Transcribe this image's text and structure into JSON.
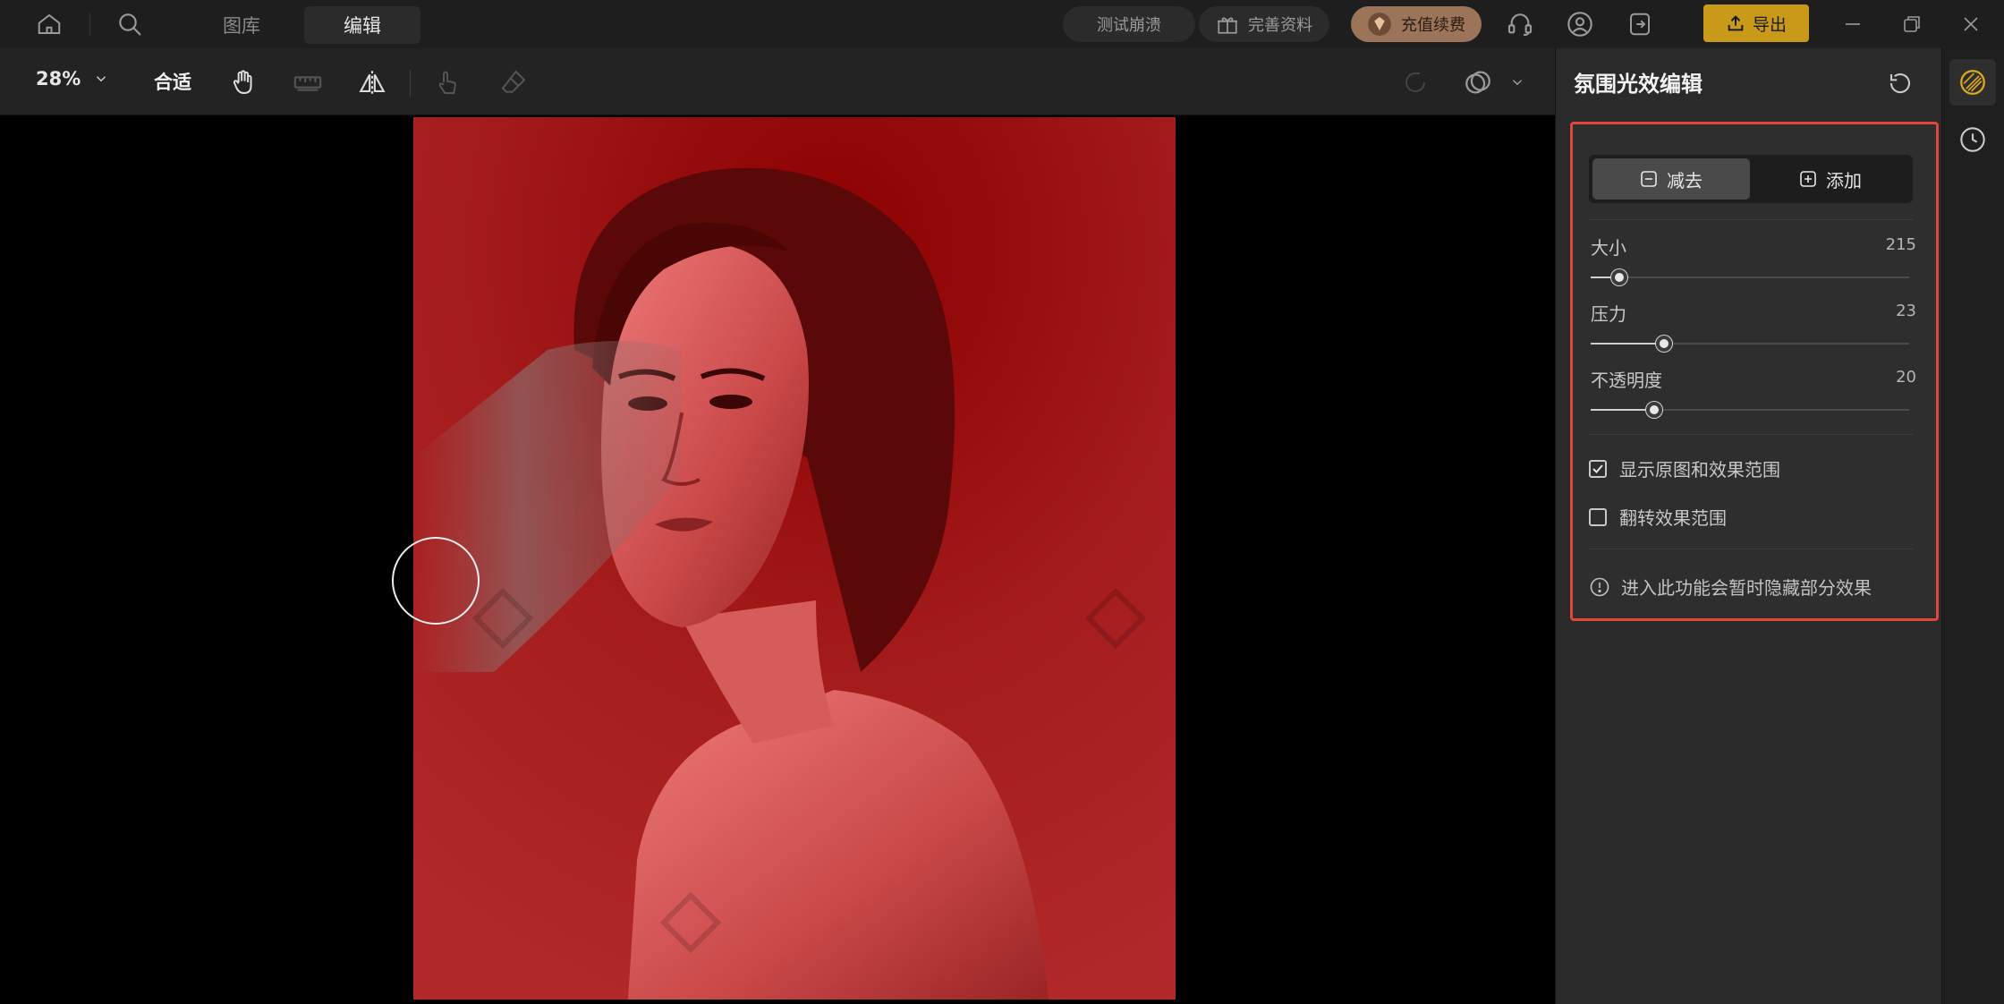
{
  "titlebar": {
    "nav": [
      {
        "label": "图库",
        "active": false
      },
      {
        "label": "编辑",
        "active": true
      }
    ],
    "pills": {
      "crash_test": "测试崩溃",
      "complete_profile": "完善资料",
      "recharge": "充值续费"
    },
    "export_label": "导出"
  },
  "toolbar": {
    "zoom": "28%",
    "fit_label": "合适"
  },
  "panel": {
    "title": "氛围光效编辑",
    "mode": {
      "subtract": "减去",
      "add": "添加",
      "active": "subtract"
    },
    "sliders": [
      {
        "label": "大小",
        "value": "215",
        "fraction": 0.09
      },
      {
        "label": "压力",
        "value": "23",
        "fraction": 0.23
      },
      {
        "label": "不透明度",
        "value": "20",
        "fraction": 0.2
      }
    ],
    "checkboxes": [
      {
        "label": "显示原图和效果范围",
        "checked": true
      },
      {
        "label": "翻转效果范围",
        "checked": false
      }
    ],
    "info": "进入此功能会暂时隐藏部分效果"
  },
  "colors": {
    "accent": "#c99a1a",
    "highlight_border": "#e0463a",
    "mask_red": "#b52a2a"
  },
  "icons": {
    "home": "home-icon",
    "search": "search-icon",
    "gift": "gift-icon",
    "gem": "gem-icon",
    "support": "headset-icon",
    "account": "user-icon",
    "logout": "logout-icon",
    "export": "upload-icon",
    "hand": "hand-icon",
    "ruler": "ruler-icon",
    "flip": "flip-icon",
    "touch": "touch-icon",
    "eraser": "eraser-icon",
    "undo": "undo-icon",
    "overlay": "overlay-icon",
    "reset": "reset-icon",
    "light_effect": "light-effect-icon",
    "history": "history-icon"
  }
}
